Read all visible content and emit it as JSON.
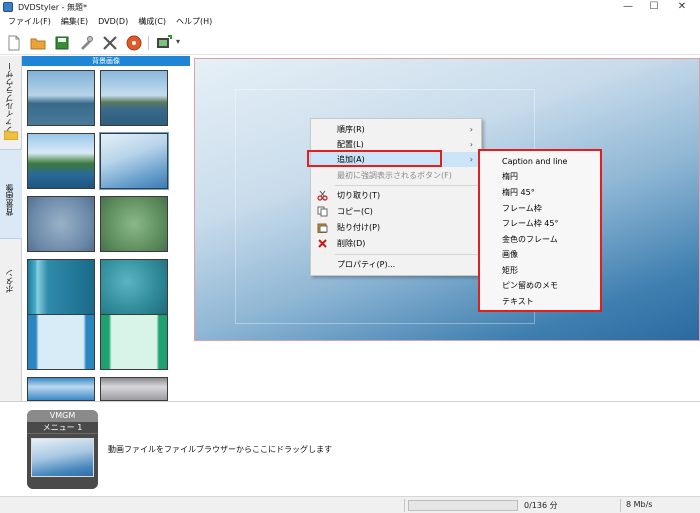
{
  "window": {
    "title": "DVDStyler - 無題*",
    "minimize": "—",
    "maximize": "☐",
    "close": "✕"
  },
  "menubar": [
    "ファイル(F)",
    "編集(E)",
    "DVD(D)",
    "構成(C)",
    "ヘルプ(H)"
  ],
  "toolbar": {
    "icons": [
      "new-file-icon",
      "open-folder-icon",
      "save-icon",
      "settings-icon",
      "tools-icon",
      "burn-disc-icon",
      "add-video-icon",
      "dropdown-arrow-icon"
    ],
    "dropdown": "▾"
  },
  "vtabs": [
    "ファイルブラウザー",
    "背景画像",
    "ボタン"
  ],
  "thumbpanel": {
    "header": "背景画像",
    "scroll_up": "▲",
    "scroll_down": "▼"
  },
  "context_menu": {
    "items": [
      {
        "label": "順序(R)",
        "submenu": true
      },
      {
        "label": "配置(L)",
        "submenu": true
      },
      {
        "label": "追加(A)",
        "submenu": true
      },
      {
        "label": "最初に強調表示されるボタン(F)",
        "disabled": true
      },
      {
        "label": "切り取り(T)",
        "icon": "scissors-icon"
      },
      {
        "label": "コピー(C)",
        "icon": "copy-icon"
      },
      {
        "label": "貼り付け(P)",
        "icon": "paste-icon"
      },
      {
        "label": "削除(D)",
        "icon": "delete-icon"
      },
      {
        "label": "プロパティ(P)..."
      }
    ],
    "arrow": "›"
  },
  "submenu": {
    "items": [
      "Caption and line",
      "楕円",
      "楕円 45°",
      "フレーム枠",
      "フレーム枠 45°",
      "金色のフレーム",
      "画像",
      "矩形",
      "ピン留めのメモ",
      "テキスト"
    ]
  },
  "bottom": {
    "vmgm_label": "VMGM",
    "menu_label": "メニュー 1",
    "hint": "動画ファイルをファイルブラウザーからここにドラッグします"
  },
  "status": {
    "duration": "0/136 分",
    "bitrate": "8 Mb/s"
  },
  "colors": {
    "accent": "#1f86d6",
    "highlight_box": "#e02020",
    "menu_hover": "#cce4f7"
  }
}
